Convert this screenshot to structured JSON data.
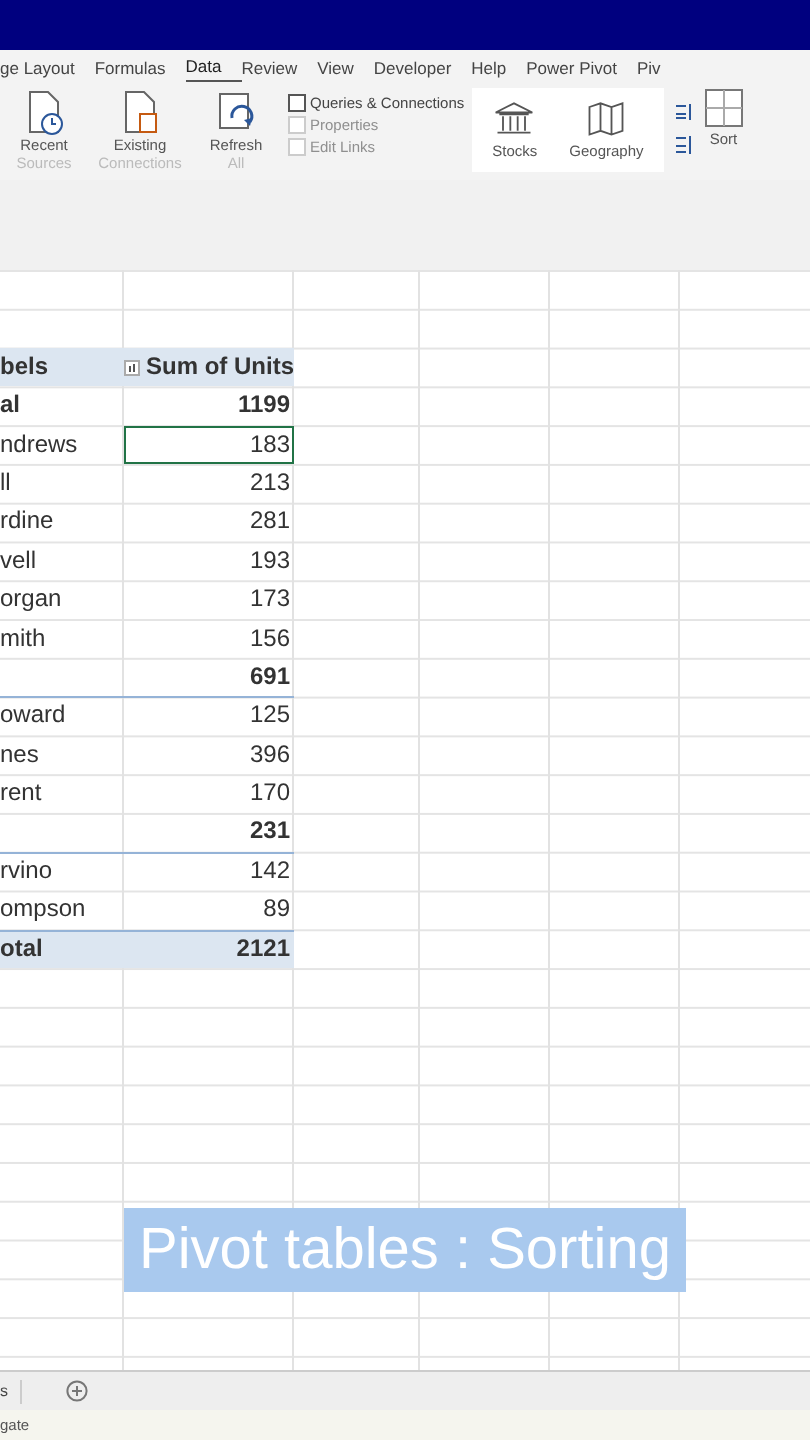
{
  "ribbon_tabs": [
    {
      "label": "ge Layout",
      "selected": false
    },
    {
      "label": "Formulas",
      "selected": false
    },
    {
      "label": "Data",
      "selected": true
    },
    {
      "label": "Review",
      "selected": false
    },
    {
      "label": "View",
      "selected": false
    },
    {
      "label": "Developer",
      "selected": false
    },
    {
      "label": "Help",
      "selected": false
    },
    {
      "label": "Power Pivot",
      "selected": false
    },
    {
      "label": "Piv",
      "selected": false
    }
  ],
  "ribbon": {
    "large_buttons": [
      {
        "kind": "recent",
        "lines": [
          "Recent",
          "Sources"
        ]
      },
      {
        "kind": "existing",
        "lines": [
          "Existing",
          "Connections"
        ]
      },
      {
        "kind": "refresh",
        "lines": [
          "Refresh",
          "All"
        ]
      }
    ],
    "small_buttons": [
      {
        "label": "Queries & Connections",
        "disabled": false
      },
      {
        "label": "Properties",
        "disabled": true
      },
      {
        "label": "Edit Links",
        "disabled": true
      }
    ],
    "data_types": [
      "Stocks",
      "Geography"
    ],
    "sort_label": "Sort"
  },
  "pivot": {
    "header_label": "bels",
    "header_value": "Sum of Units",
    "rows": [
      {
        "label": "al",
        "value": "1199",
        "kind": "group",
        "rule_above": false,
        "selected": false
      },
      {
        "label": "ndrews",
        "value": "183",
        "kind": "item",
        "rule_above": false,
        "selected": true
      },
      {
        "label": "ll",
        "value": "213",
        "kind": "item",
        "rule_above": false,
        "selected": false
      },
      {
        "label": "rdine",
        "value": "281",
        "kind": "item",
        "rule_above": false,
        "selected": false
      },
      {
        "label": "vell",
        "value": "193",
        "kind": "item",
        "rule_above": false,
        "selected": false
      },
      {
        "label": "organ",
        "value": "173",
        "kind": "item",
        "rule_above": false,
        "selected": false
      },
      {
        "label": "mith",
        "value": "156",
        "kind": "item",
        "rule_above": false,
        "selected": false
      },
      {
        "label": "",
        "value": "691",
        "kind": "group",
        "rule_above": false,
        "selected": false
      },
      {
        "label": "oward",
        "value": "125",
        "kind": "item",
        "rule_above": true,
        "selected": false
      },
      {
        "label": "nes",
        "value": "396",
        "kind": "item",
        "rule_above": false,
        "selected": false
      },
      {
        "label": "rent",
        "value": "170",
        "kind": "item",
        "rule_above": false,
        "selected": false
      },
      {
        "label": "",
        "value": "231",
        "kind": "group",
        "rule_above": false,
        "selected": false
      },
      {
        "label": "rvino",
        "value": "142",
        "kind": "item",
        "rule_above": true,
        "selected": false
      },
      {
        "label": "ompson",
        "value": "89",
        "kind": "item",
        "rule_above": false,
        "selected": false
      },
      {
        "label": "otal",
        "value": "2121",
        "kind": "grand_total",
        "rule_above": true,
        "selected": false
      }
    ]
  },
  "sheet_tab": "s",
  "status_bar": "gate",
  "caption": "Pivot tables : Sorting"
}
